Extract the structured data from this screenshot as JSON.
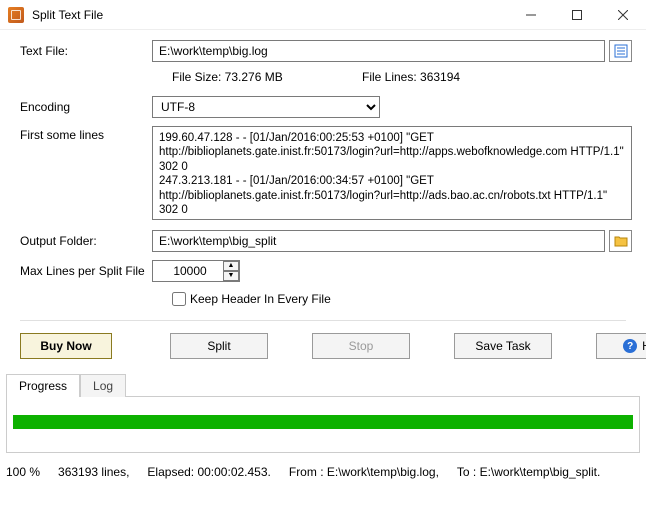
{
  "window": {
    "title": "Split Text File"
  },
  "labels": {
    "textFile": "Text File:",
    "encoding": "Encoding",
    "firstLines": "First some lines",
    "outputFolder": "Output Folder:",
    "maxLines": "Max Lines per Split File",
    "keepHeader": "Keep Header In Every File"
  },
  "fields": {
    "textFile": "E:\\work\\temp\\big.log",
    "encoding": "UTF-8",
    "outputFolder": "E:\\work\\temp\\big_split",
    "maxLines": "10000"
  },
  "fileInfo": {
    "sizeLabel": "File Size: 73.276 MB",
    "linesLabel": "File Lines: 363194"
  },
  "preview": "199.60.47.128 - - [01/Jan/2016:00:25:53 +0100] \"GET http://biblioplanets.gate.inist.fr:50173/login?url=http://apps.webofknowledge.com HTTP/1.1\" 302 0\n247.3.213.181 - - [01/Jan/2016:00:34:57 +0100] \"GET http://biblioplanets.gate.inist.fr:50173/login?url=http://ads.bao.ac.cn/robots.txt HTTP/1.1\" 302 0",
  "buttons": {
    "buy": "Buy Now",
    "split": "Split",
    "stop": "Stop",
    "saveTask": "Save Task",
    "help": "Help"
  },
  "tabs": {
    "progress": "Progress",
    "log": "Log"
  },
  "status": {
    "percent": "100 %",
    "lines": "363193 lines,",
    "elapsed": "Elapsed: 00:00:02.453.",
    "from": "From : E:\\work\\temp\\big.log,",
    "to": "To : E:\\work\\temp\\big_split."
  }
}
